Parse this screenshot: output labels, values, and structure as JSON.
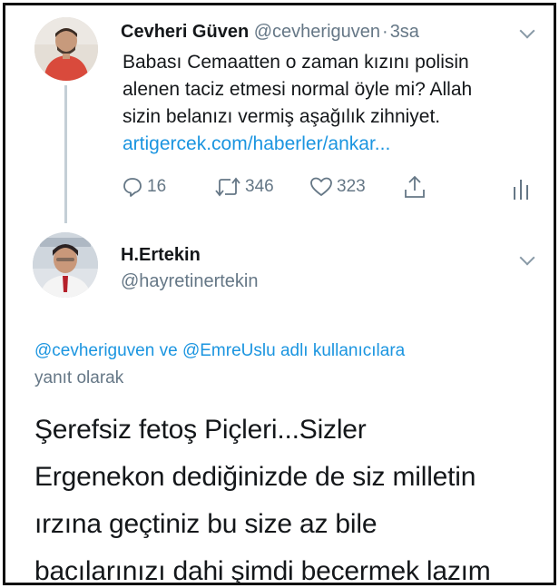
{
  "parent_tweet": {
    "display_name": "Cevheri Güven",
    "handle": "@cevheriguven",
    "separator": "·",
    "time": "3sa",
    "text_lines": [
      "Babası Cemaatten o zaman kızını polisin",
      "alenen taciz etmesi normal öyle mi? Allah",
      "sizin belanızı vermiş aşağılık zihniyet."
    ],
    "link": "artigercek.com/haberler/ankar...",
    "actions": {
      "reply_icon": "reply-icon",
      "reply_count": "16",
      "retweet_icon": "retweet-icon",
      "retweet_count": "346",
      "like_icon": "heart-icon",
      "like_count": "323",
      "share_icon": "share-icon",
      "analytics_icon": "analytics-icon"
    }
  },
  "reply_tweet": {
    "display_name": "H.Ertekin",
    "handle": "@hayretinertekin",
    "replying_mention_1": "@cevheriguven",
    "replying_connector": "ve",
    "replying_mention_2": "@EmreUslu",
    "replying_suffix_1": "adlı kullanıcılara",
    "replying_suffix_2": "yanıt olarak",
    "text_lines": [
      "Şerefsiz fetoş Piçleri...Sizler",
      "Ergenekon dediğinizde de siz milletin",
      "ırzına geçtiniz bu size az bile",
      "bacılarınızı dahi şimdi becermek lazım"
    ]
  },
  "colors": {
    "link": "#1b95e0",
    "secondary_text": "#657786",
    "primary_text": "#14171a",
    "thread_line": "#c4cfd6"
  }
}
